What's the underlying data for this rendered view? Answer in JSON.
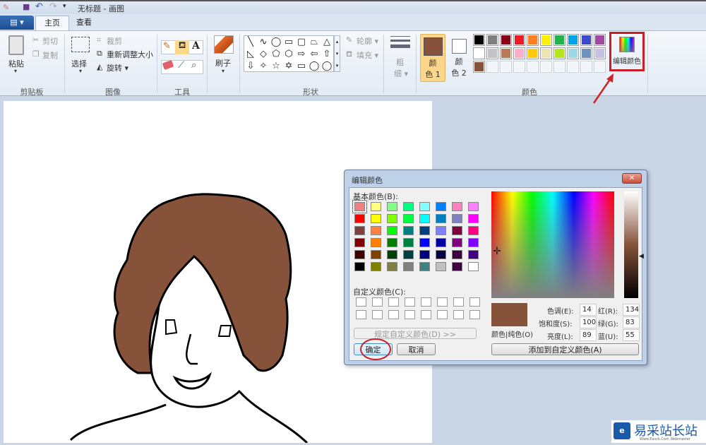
{
  "window": {
    "title": "无标题 - 画图"
  },
  "tabs": {
    "file": "▤ ▾",
    "home": "主页",
    "view": "查看"
  },
  "ribbon": {
    "clipboard": {
      "paste": "粘贴",
      "cut": "剪切",
      "copy": "复制",
      "group": "剪贴板"
    },
    "image": {
      "select": "选择",
      "crop": "裁剪",
      "resize": "重新调整大小",
      "rotate": "旋转 ▾",
      "group": "图像"
    },
    "tools": {
      "group": "工具"
    },
    "brushes": {
      "label": "刷子"
    },
    "shapes": {
      "outline": "轮廓 ▾",
      "fill": "填充 ▾",
      "group": "形状",
      "glyphs": [
        "╲",
        "∿",
        "◯",
        "▭",
        "▢",
        "⏢",
        "△",
        "◺",
        "◇",
        "⬠",
        "⬡",
        "⇨",
        "⇦",
        "⇧",
        "⇩",
        "✧",
        "☆",
        "✡",
        "▭",
        "◯",
        "◯"
      ]
    },
    "size": {
      "label1": "粗",
      "label2": "细 ▾"
    },
    "colors": {
      "color1_a": "颜",
      "color1_b": "色 1",
      "color2_a": "颜",
      "color2_b": "色 2",
      "edit": "编辑颜色",
      "group": "颜色",
      "color1_value": "#86533a",
      "color2_value": "#ffffff",
      "palette": [
        [
          "#000000",
          "#7f7f7f",
          "#880015",
          "#ed1c24",
          "#ff7f27",
          "#fff200",
          "#22b14c",
          "#00a2e8",
          "#3f48cc",
          "#a349a4"
        ],
        [
          "#ffffff",
          "#c3c3c3",
          "#b97a57",
          "#ffaec9",
          "#ffc90e",
          "#efe4b0",
          "#b5e61d",
          "#99d9ea",
          "#7092be",
          "#c8bfe7"
        ],
        [
          "#86533a",
          "",
          "",
          "",
          "",
          "",
          "",
          "",
          "",
          ""
        ]
      ]
    }
  },
  "dialog": {
    "title": "编辑颜色",
    "close": "✕",
    "basic_label": "基本颜色(B):",
    "basic_colors": [
      [
        "#f08080",
        "#ffff80",
        "#80ff80",
        "#00ff80",
        "#80ffff",
        "#0080ff",
        "#ff80c0",
        "#ff80ff"
      ],
      [
        "#ff0000",
        "#ffff00",
        "#80ff00",
        "#00ff40",
        "#00ffff",
        "#0080c0",
        "#8080c0",
        "#ff00ff"
      ],
      [
        "#804040",
        "#ff8040",
        "#00ff00",
        "#008080",
        "#004080",
        "#8080ff",
        "#800040",
        "#ff0080"
      ],
      [
        "#800000",
        "#ff8000",
        "#008000",
        "#008040",
        "#0000ff",
        "#0000a0",
        "#800080",
        "#8000ff"
      ],
      [
        "#400000",
        "#804000",
        "#004000",
        "#004040",
        "#000080",
        "#000040",
        "#400040",
        "#400080"
      ],
      [
        "#000000",
        "#808000",
        "#808040",
        "#808080",
        "#408080",
        "#c0c0c0",
        "#400040",
        "#ffffff"
      ]
    ],
    "custom_label": "自定义颜色(C):",
    "define_custom": "规定自定义颜色(D) >>",
    "ok": "确定",
    "cancel": "取消",
    "preview_label": "颜色|纯色(O)",
    "preview_color": "#86533a",
    "hue_label": "色调(E):",
    "hue": "14",
    "sat_label": "饱和度(S):",
    "sat": "100",
    "lum_label": "亮度(L):",
    "lum": "89",
    "red_label": "红(R):",
    "red": "134",
    "green_label": "绿(G):",
    "green": "83",
    "blue_label": "蓝(U):",
    "blue": "55",
    "add_custom": "添加到自定义颜色(A)"
  },
  "annotation_color": "#d0202a",
  "watermark": {
    "text": "易采站长站",
    "sub": "Www.Easck.Com Webmaster"
  }
}
